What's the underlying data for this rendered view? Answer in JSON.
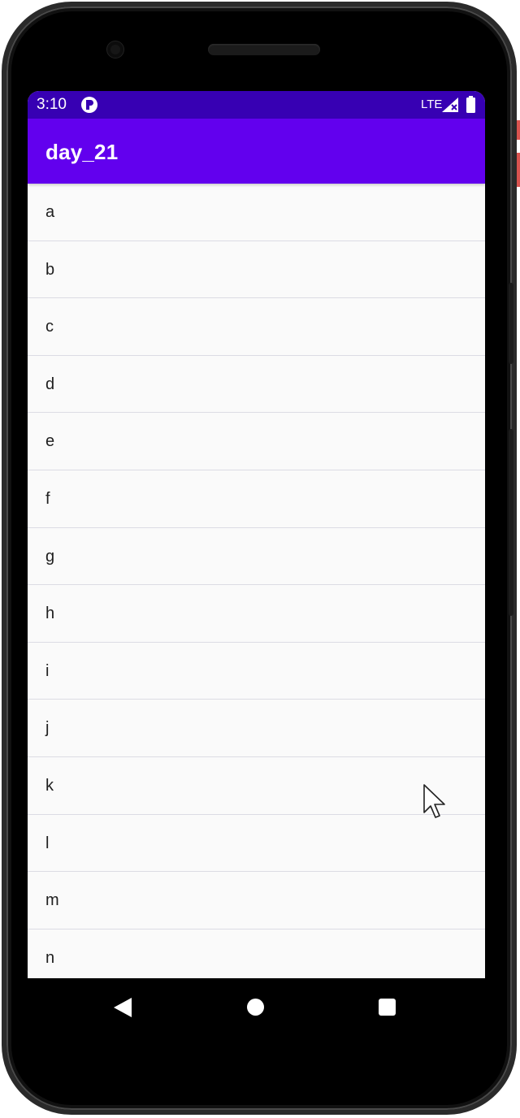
{
  "status_bar": {
    "time": "3:10",
    "network": "LTE",
    "color": "#3700b3"
  },
  "app_bar": {
    "title": "day_21",
    "color": "#6200ee"
  },
  "list": {
    "items": [
      {
        "label": "a"
      },
      {
        "label": "b"
      },
      {
        "label": "c"
      },
      {
        "label": "d"
      },
      {
        "label": "e"
      },
      {
        "label": "f"
      },
      {
        "label": "g"
      },
      {
        "label": "h"
      },
      {
        "label": "i"
      },
      {
        "label": "j"
      },
      {
        "label": "k"
      },
      {
        "label": "l"
      },
      {
        "label": "m"
      },
      {
        "label": "n"
      }
    ]
  },
  "nav_bar": {
    "icons": [
      "back-icon",
      "home-icon",
      "recents-icon"
    ]
  }
}
